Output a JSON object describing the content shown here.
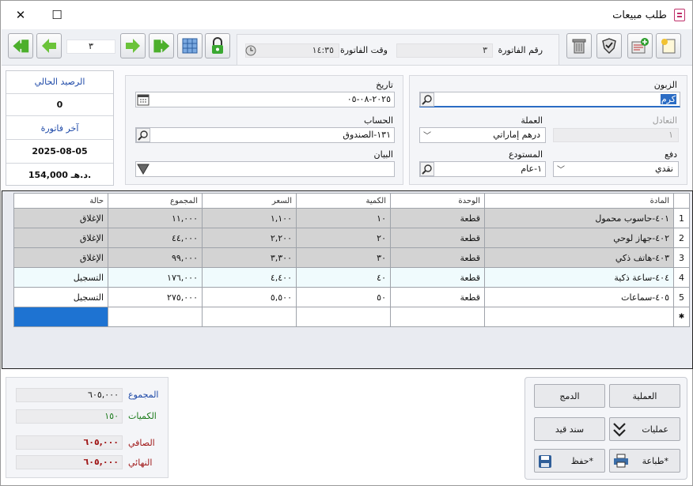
{
  "window": {
    "title": "طلب مبيعات",
    "close": "✕",
    "maximize": "☐"
  },
  "toolbar": {
    "record_number": "٣"
  },
  "invoice": {
    "number_label": "رقم الفاتورة",
    "number_value": "٣",
    "time_label": "وقت الفاتورة",
    "time_value": "١٤:٣٥"
  },
  "customer": {
    "label": "الزبون",
    "value": "كرم"
  },
  "balance": {
    "label": "التعادل",
    "value": "١"
  },
  "currency": {
    "label": "العملة",
    "value": "درهم إماراتي"
  },
  "payment": {
    "label": "دفع",
    "value": "نقدي"
  },
  "warehouse": {
    "label": "المستودع",
    "value": "١-عام"
  },
  "date": {
    "label": "تاريخ",
    "value": "٢٠٢٥-٠٨-٠٥"
  },
  "account": {
    "label": "الحساب",
    "value": "١٣١-الصندوق"
  },
  "statement": {
    "label": "البيان",
    "value": ""
  },
  "side": {
    "current_balance_label": "الرصيد الحالي",
    "current_balance_value": "0",
    "last_invoice_label": "آخر فاتورة",
    "last_invoice_date": "2025-08-05",
    "last_invoice_amount": "154,000 د.هـ."
  },
  "grid": {
    "headers": {
      "item": "المادة",
      "unit": "الوحدة",
      "qty": "الكمية",
      "price": "السعر",
      "total": "المجموع",
      "status": "حالة"
    },
    "rows": [
      {
        "n": "1",
        "item": "٤٠١-حاسوب محمول",
        "unit": "قطعة",
        "qty": "١٠",
        "price": "١,١٠٠",
        "total": "١١,٠٠٠",
        "status": "الإغلاق"
      },
      {
        "n": "2",
        "item": "٤٠٢-جهاز لوحي",
        "unit": "قطعة",
        "qty": "٢٠",
        "price": "٢,٢٠٠",
        "total": "٤٤,٠٠٠",
        "status": "الإغلاق"
      },
      {
        "n": "3",
        "item": "٤٠٣-هاتف ذكي",
        "unit": "قطعة",
        "qty": "٣٠",
        "price": "٣,٣٠٠",
        "total": "٩٩,٠٠٠",
        "status": "الإغلاق"
      },
      {
        "n": "4",
        "item": "٤٠٤-ساعة ذكية",
        "unit": "قطعة",
        "qty": "٤٠",
        "price": "٤,٤٠٠",
        "total": "١٧٦,٠٠٠",
        "status": "التسجيل"
      },
      {
        "n": "5",
        "item": "٤٠٥-سماعات",
        "unit": "قطعة",
        "qty": "٥٠",
        "price": "٥,٥٠٠",
        "total": "٢٧٥,٠٠٠",
        "status": "التسجيل"
      }
    ],
    "new_row_marker": "✱"
  },
  "summary": {
    "total_label": "المجموع",
    "total_value": "٦٠٥,٠٠٠",
    "qty_label": "الكميات",
    "qty_value": "١٥٠",
    "net_label": "الصافي",
    "net_value": "٦٠٥,٠٠٠",
    "final_label": "النهائي",
    "final_value": "٦٠٥,٠٠٠"
  },
  "actions": {
    "operation": "العملية",
    "merge": "الدمج",
    "operations": "عمليات",
    "journal": "سند قيد",
    "print": "طباعة*",
    "save": "حفظ*"
  },
  "colors": {
    "accent": "#2b6cc4",
    "green_label": "#1a7a1a",
    "red_value": "#a01818",
    "blue_label": "#1f4aa8",
    "gray_row": "#d3d3d3",
    "light_row": "#f0fbfd"
  }
}
